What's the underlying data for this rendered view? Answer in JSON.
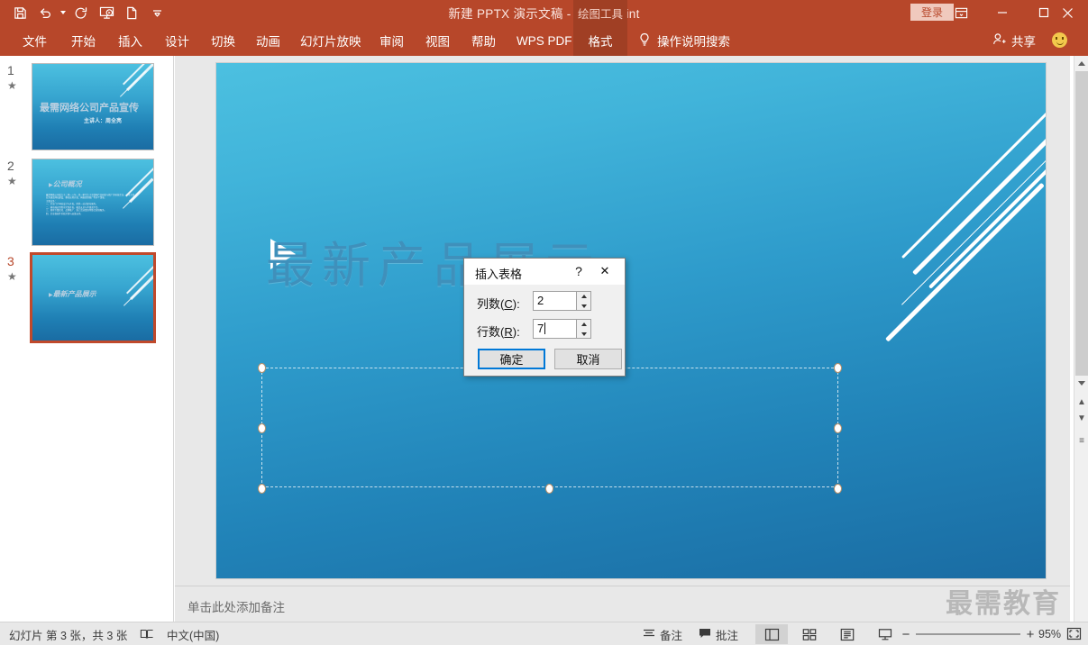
{
  "titlebar": {
    "document_title": "新建 PPTX 演示文稿  -  PowerPoint",
    "contextual_tab_group": "绘图工具",
    "login_label": "登录",
    "quick_access": [
      {
        "name": "save-icon",
        "label": "保存"
      },
      {
        "name": "undo-icon",
        "label": "撤消"
      },
      {
        "name": "redo-icon",
        "label": "恢复"
      },
      {
        "name": "start-slideshow-icon",
        "label": "从头开始"
      },
      {
        "name": "new-file-icon",
        "label": "新建"
      },
      {
        "name": "customize-qat-icon",
        "label": "自定义快速访问工具栏"
      }
    ],
    "window_buttons": {
      "ribbon_display": "功能区显示选项",
      "minimize": "最小化",
      "maximize": "最大化",
      "close": "关闭"
    }
  },
  "ribbon": {
    "tabs": [
      {
        "label": "文件",
        "active": false
      },
      {
        "label": "开始",
        "active": false
      },
      {
        "label": "插入",
        "active": false
      },
      {
        "label": "设计",
        "active": false
      },
      {
        "label": "切换",
        "active": false
      },
      {
        "label": "动画",
        "active": false
      },
      {
        "label": "幻灯片放映",
        "active": false
      },
      {
        "label": "审阅",
        "active": false
      },
      {
        "label": "视图",
        "active": false
      },
      {
        "label": "帮助",
        "active": false
      },
      {
        "label": "WPS PDF",
        "active": false
      },
      {
        "label": "格式",
        "active": true
      }
    ],
    "tell_me": "操作说明搜索",
    "share_label": "共享"
  },
  "slides_panel": {
    "slides": [
      {
        "number": "1",
        "selected": false,
        "title": "最需网络公司产品宣传",
        "subtitle": "主讲人：周全亮",
        "body": ""
      },
      {
        "number": "2",
        "selected": false,
        "title": "公司概况",
        "subtitle": "",
        "body": "最需网络公司成立于二零一八年，是一家专注于互联网产品研发与推广的科技企业。公司主营业务涵盖网站建设、移动应用开发、网络营销推广等多个领域。\n主要业务：\n一、企业门户网站设计与开发，提供一站式建站服务。\n二、移动端应用程序定制开发，覆盖安卓与苹果双平台。\n三、搜索引擎优化、品牌推广、线上活动策划等整合营销服务。\n四、企业级软件系统定制与运维支持。"
      },
      {
        "number": "3",
        "selected": true,
        "title": "最新产品展示",
        "subtitle": "",
        "body": ""
      }
    ]
  },
  "slide_editor": {
    "title_text": "最新产品展示",
    "title_bullet": "triangle-bullet-icon",
    "content_placeholder_selected": true
  },
  "notes": {
    "placeholder": "单击此处添加备注",
    "watermark": "最需教育"
  },
  "statusbar": {
    "slide_counter": "幻灯片 第 3 张，共 3 张",
    "spellcheck_icon": "proofing-icon",
    "language": "中文(中国)",
    "notes_label": "备注",
    "comments_label": "批注",
    "views": [
      {
        "name": "view-normal",
        "label": "普通视图",
        "active": true
      },
      {
        "name": "view-slide-sorter",
        "label": "幻灯片浏览",
        "active": false
      },
      {
        "name": "view-reading",
        "label": "阅读视图",
        "active": false
      },
      {
        "name": "view-slideshow",
        "label": "幻灯片放映",
        "active": false
      }
    ],
    "zoom_out": "−",
    "zoom_in": "+",
    "zoom_level": "95%",
    "fit_label": "使幻灯片适应当前窗口"
  },
  "dialog": {
    "title": "插入表格",
    "help_glyph": "?",
    "close_glyph": "✕",
    "columns": {
      "label_prefix": "列数(",
      "label_key": "C",
      "label_suffix": "):",
      "value": "2"
    },
    "rows": {
      "label_prefix": "行数(",
      "label_key": "R",
      "label_suffix": "):",
      "value": "7"
    },
    "ok_label": "确定",
    "cancel_label": "取消"
  },
  "colors": {
    "ribbon_red": "#b7472a",
    "ribbon_red_dark": "#a03f24",
    "selection_accent": "#c0492b",
    "dialog_focus_blue": "#0078d7",
    "slide_top": "#4cc0e0",
    "slide_bottom": "#1a6ca3"
  }
}
